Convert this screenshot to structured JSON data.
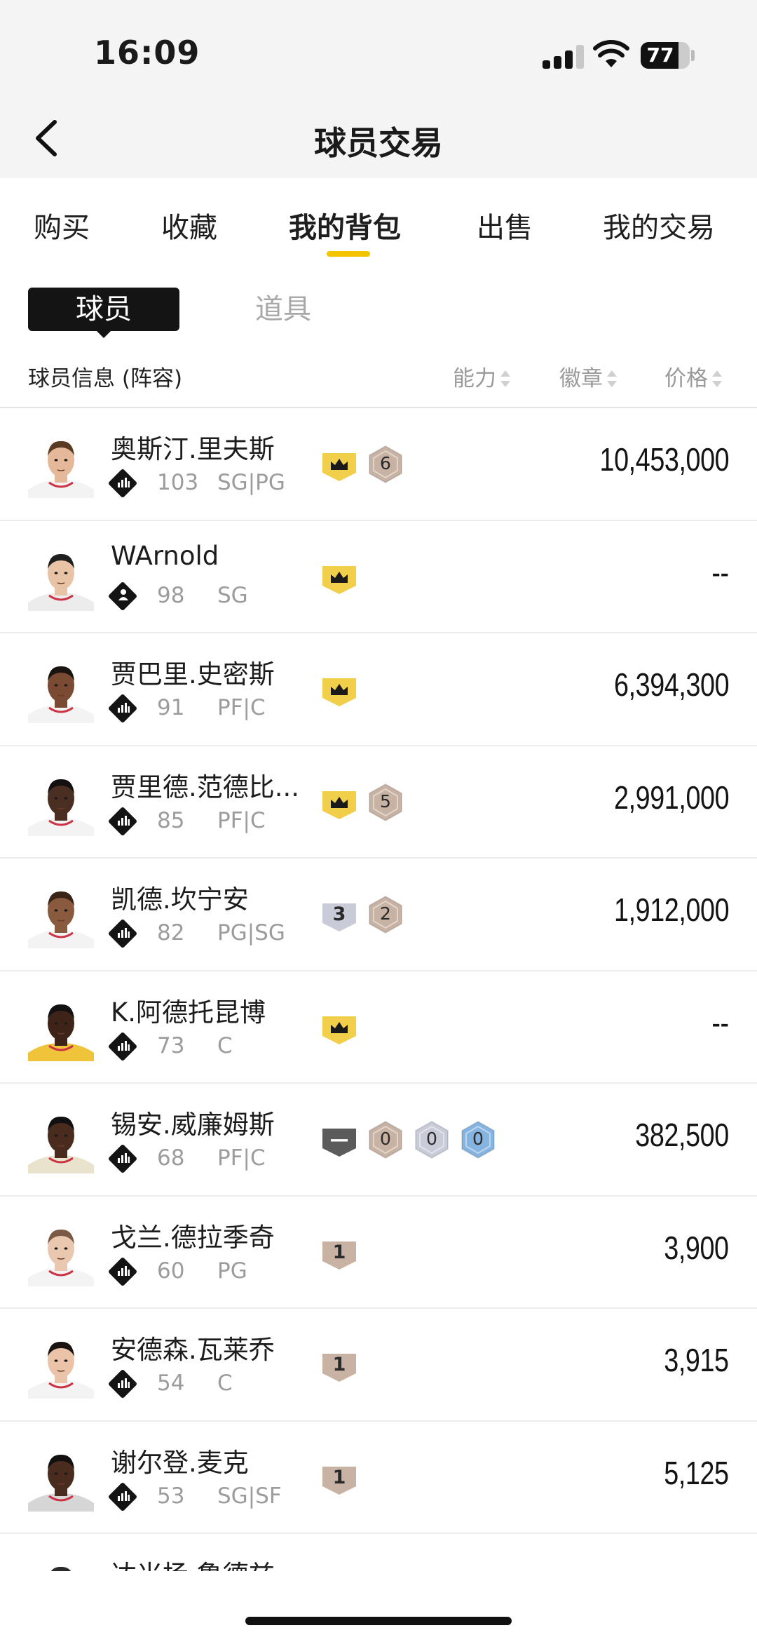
{
  "status": {
    "time": "16:09",
    "battery": "77",
    "battery_level": 0.77
  },
  "nav": {
    "title": "球员交易"
  },
  "tabs": [
    {
      "label": "购买",
      "active": false
    },
    {
      "label": "收藏",
      "active": false
    },
    {
      "label": "我的背包",
      "active": true
    },
    {
      "label": "出售",
      "active": false
    },
    {
      "label": "我的交易",
      "active": false
    }
  ],
  "segments": {
    "player": "球员",
    "item": "道具"
  },
  "header": {
    "info": "球员信息 (阵容)",
    "ability": "能力",
    "badge": "徽章",
    "price": "价格"
  },
  "colors": {
    "accent": "#f5c400",
    "crown_badge": "#f2cf4a",
    "bronze_badge": "#c8b2a3",
    "silver_badge": "#c9ccd8",
    "blue_badge": "#86b4e0",
    "dark_badge": "#5b5b5b"
  },
  "players": [
    {
      "name": "奥斯汀.里夫斯",
      "rating": "103",
      "pos": "SG|PG",
      "price": "10,453,000",
      "icon": "stats-icon",
      "skin": "#e6b89a",
      "hair": "#5a3a22",
      "jersey": "#f3f3f3",
      "badges": [
        {
          "kind": "crown",
          "text": ""
        },
        {
          "kind": "hex",
          "text": "6",
          "color": "#c8b2a3"
        }
      ]
    },
    {
      "name": "WArnold",
      "rating": "98",
      "pos": "SG",
      "price": "--",
      "icon": "person-icon",
      "skin": "#e9c3a6",
      "hair": "#1f1f1f",
      "jersey": "#ececec",
      "badges": [
        {
          "kind": "crown",
          "text": ""
        }
      ]
    },
    {
      "name": "贾巴里.史密斯",
      "rating": "91",
      "pos": "PF|C",
      "price": "6,394,300",
      "icon": "stats-icon",
      "skin": "#7a4a33",
      "hair": "#1a1410",
      "jersey": "#f3f3f3",
      "badges": [
        {
          "kind": "crown",
          "text": ""
        }
      ]
    },
    {
      "name": "贾里德.范德比...",
      "rating": "85",
      "pos": "PF|C",
      "price": "2,991,000",
      "icon": "stats-icon",
      "skin": "#4a2e22",
      "hair": "#141010",
      "jersey": "#f3f3f3",
      "badges": [
        {
          "kind": "crown",
          "text": ""
        },
        {
          "kind": "hex",
          "text": "5",
          "color": "#c8b2a3"
        }
      ]
    },
    {
      "name": "凯德.坎宁安",
      "rating": "82",
      "pos": "PG|SG",
      "price": "1,912,000",
      "icon": "stats-icon",
      "skin": "#8a5a3e",
      "hair": "#3a2418",
      "jersey": "#f3f3f3",
      "badges": [
        {
          "kind": "shield",
          "text": "3",
          "color": "#c9ccd8"
        },
        {
          "kind": "hex",
          "text": "2",
          "color": "#c8b2a3"
        }
      ]
    },
    {
      "name": "K.阿德托昆博",
      "rating": "73",
      "pos": "C",
      "price": "--",
      "icon": "stats-icon",
      "skin": "#3e2418",
      "hair": "#121010",
      "jersey": "#f0c43a",
      "badges": [
        {
          "kind": "crown",
          "text": ""
        }
      ]
    },
    {
      "name": "锡安.威廉姆斯",
      "rating": "68",
      "pos": "PF|C",
      "price": "382,500",
      "icon": "stats-icon",
      "skin": "#4a2c1e",
      "hair": "#121010",
      "jersey": "#e9e2cc",
      "badges": [
        {
          "kind": "shield",
          "text": "—",
          "color": "#5b5b5b"
        },
        {
          "kind": "hex",
          "text": "0",
          "color": "#c8b2a3"
        },
        {
          "kind": "hex",
          "text": "0",
          "color": "#c9ccd8"
        },
        {
          "kind": "hex",
          "text": "0",
          "color": "#86b4e0"
        }
      ]
    },
    {
      "name": "戈兰.德拉季奇",
      "rating": "60",
      "pos": "PG",
      "price": "3,900",
      "icon": "stats-icon",
      "skin": "#eac8b0",
      "hair": "#7a5a44",
      "jersey": "#f3f3f3",
      "badges": [
        {
          "kind": "shield",
          "text": "1",
          "color": "#c8b2a3"
        }
      ]
    },
    {
      "name": "安德森.瓦莱乔",
      "rating": "54",
      "pos": "C",
      "price": "3,915",
      "icon": "stats-icon",
      "skin": "#eac3a8",
      "hair": "#1a1410",
      "jersey": "#f3f3f3",
      "badges": [
        {
          "kind": "shield",
          "text": "1",
          "color": "#c8b2a3"
        }
      ]
    },
    {
      "name": "谢尔登.麦克",
      "rating": "53",
      "pos": "SG|SF",
      "price": "5,125",
      "icon": "stats-icon",
      "skin": "#4a2c1e",
      "hair": "#121010",
      "jersey": "#d6d6d6",
      "badges": [
        {
          "kind": "shield",
          "text": "1",
          "color": "#c8b2a3"
        }
      ]
    },
    {
      "name": "达米扬.鲁德兹",
      "rating": "",
      "pos": "",
      "price": "",
      "icon": "stats-icon",
      "skin": "#eac8b0",
      "hair": "#2a2a2a",
      "jersey": "#f3f3f3",
      "badges": []
    }
  ]
}
